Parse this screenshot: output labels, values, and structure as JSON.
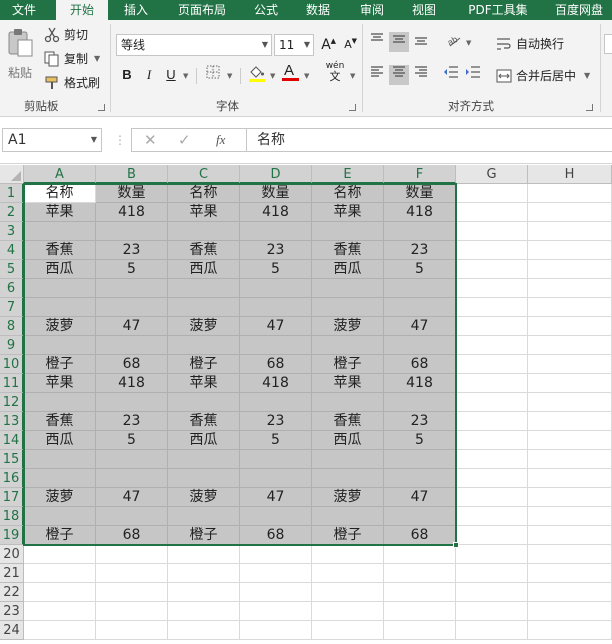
{
  "ribbon": {
    "tabs": [
      {
        "label": "文件",
        "active": false
      },
      {
        "label": "开始",
        "active": true
      },
      {
        "label": "插入",
        "active": false
      },
      {
        "label": "页面布局",
        "active": false
      },
      {
        "label": "公式",
        "active": false
      },
      {
        "label": "数据",
        "active": false
      },
      {
        "label": "审阅",
        "active": false
      },
      {
        "label": "视图",
        "active": false
      },
      {
        "label": "PDF工具集",
        "active": false
      },
      {
        "label": "百度网盘",
        "active": false
      }
    ],
    "clipboard": {
      "paste_label": "粘贴",
      "cut_label": "剪切",
      "copy_label": "复制",
      "format_painter_label": "格式刷",
      "group_label": "剪贴板"
    },
    "font": {
      "font_name": "等线",
      "font_size": "11",
      "bold": "B",
      "italic": "I",
      "underline": "U",
      "group_label": "字体",
      "increase": "A",
      "decrease": "A",
      "phonetic": "wén",
      "font_color_glyph": "A"
    },
    "alignment": {
      "wrap_text_label": "自动换行",
      "merge_center_label": "合并后居中",
      "group_label": "对齐方式"
    },
    "colors": {
      "accent": "#217346",
      "fill_yellow": "#ffff00",
      "font_red": "#e00000"
    }
  },
  "formula_bar": {
    "name_box": "A1",
    "fx": "fx",
    "content": "名称"
  },
  "sheet": {
    "columns": [
      "A",
      "B",
      "C",
      "D",
      "E",
      "F",
      "G",
      "H"
    ],
    "rows": [
      [
        "名称",
        "数量",
        "名称",
        "数量",
        "名称",
        "数量"
      ],
      [
        "苹果",
        "418",
        "苹果",
        "418",
        "苹果",
        "418"
      ],
      [
        "",
        "",
        "",
        "",
        "",
        ""
      ],
      [
        "香蕉",
        "23",
        "香蕉",
        "23",
        "香蕉",
        "23"
      ],
      [
        "西瓜",
        "5",
        "西瓜",
        "5",
        "西瓜",
        "5"
      ],
      [
        "",
        "",
        "",
        "",
        "",
        ""
      ],
      [
        "",
        "",
        "",
        "",
        "",
        ""
      ],
      [
        "菠萝",
        "47",
        "菠萝",
        "47",
        "菠萝",
        "47"
      ],
      [
        "",
        "",
        "",
        "",
        "",
        ""
      ],
      [
        "橙子",
        "68",
        "橙子",
        "68",
        "橙子",
        "68"
      ],
      [
        "苹果",
        "418",
        "苹果",
        "418",
        "苹果",
        "418"
      ],
      [
        "",
        "",
        "",
        "",
        "",
        ""
      ],
      [
        "香蕉",
        "23",
        "香蕉",
        "23",
        "香蕉",
        "23"
      ],
      [
        "西瓜",
        "5",
        "西瓜",
        "5",
        "西瓜",
        "5"
      ],
      [
        "",
        "",
        "",
        "",
        "",
        ""
      ],
      [
        "",
        "",
        "",
        "",
        "",
        ""
      ],
      [
        "菠萝",
        "47",
        "菠萝",
        "47",
        "菠萝",
        "47"
      ],
      [
        "",
        "",
        "",
        "",
        "",
        ""
      ],
      [
        "橙子",
        "68",
        "橙子",
        "68",
        "橙子",
        "68"
      ]
    ],
    "row_numbers": [
      "1",
      "2",
      "3",
      "4",
      "5",
      "6",
      "7",
      "8",
      "9",
      "10",
      "11",
      "12",
      "13",
      "14",
      "15",
      "16",
      "17",
      "18",
      "19",
      "20",
      "21",
      "22",
      "23",
      "24"
    ]
  }
}
